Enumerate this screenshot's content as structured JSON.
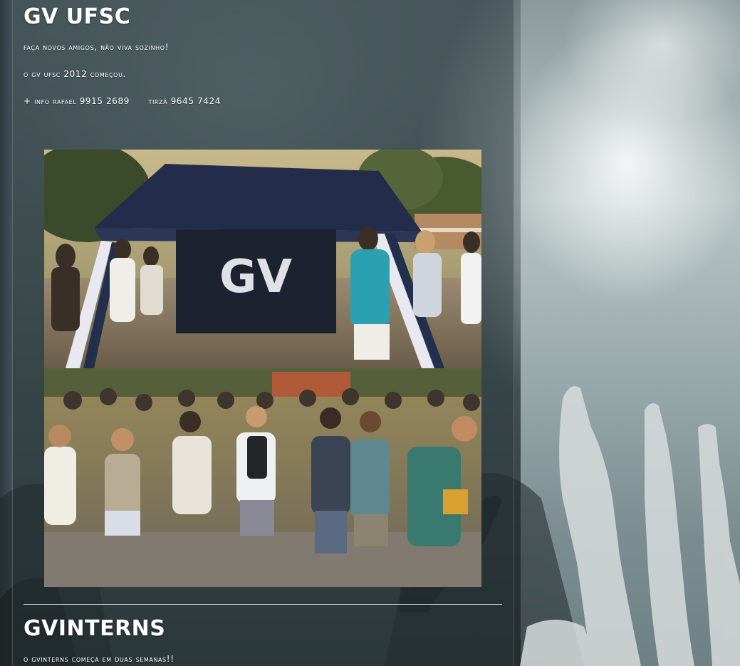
{
  "post1": {
    "title": "GV UFSC",
    "lines": [
      "Faça novos amigos, não viva sozinho!",
      "O GV UFSC 2012 começou.",
      "+ info Rafael 9915 2689      Tirzá 9645 7424"
    ],
    "photo_top_label": "GV",
    "photo_top_desc": "GV tent with students",
    "photo_bottom_desc": "crowd of students"
  },
  "post2": {
    "title": "GVINTERNS",
    "lines": [
      "O GVINTERNS começa em duas semanas!!"
    ]
  },
  "colors": {
    "text": "#ffffff",
    "tent": "#1f2a45",
    "panel": "#28373a"
  }
}
